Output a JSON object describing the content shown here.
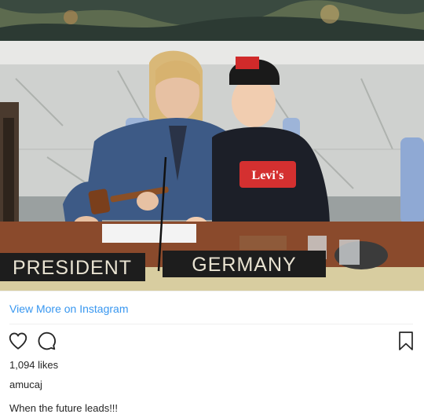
{
  "post": {
    "placards": {
      "left": "PRESIDENT",
      "right": "GERMANY"
    },
    "view_more_label": "View More on Instagram",
    "likes_text": "1,094 likes",
    "username": "amucaj",
    "caption": "When the future leads!!!"
  },
  "icons": {
    "like": "heart-icon",
    "comment": "comment-icon",
    "save": "bookmark-icon"
  },
  "colors": {
    "link": "#3897f0",
    "text": "#262626",
    "divider": "#efefef"
  }
}
